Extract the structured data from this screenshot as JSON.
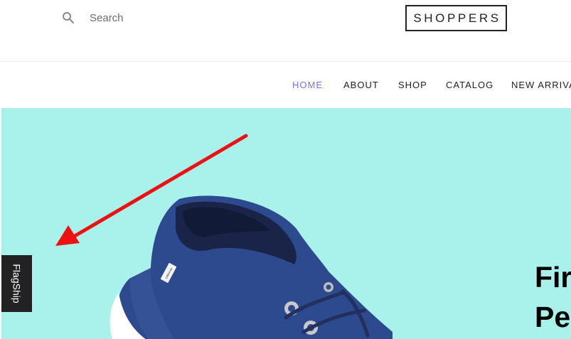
{
  "header": {
    "search": {
      "icon": "search-icon",
      "placeholder": "Search"
    },
    "logo_text": "SHOPPERS"
  },
  "nav": {
    "items": [
      {
        "label": "HOME",
        "active": true
      },
      {
        "label": "ABOUT",
        "active": false
      },
      {
        "label": "SHOP",
        "active": false
      },
      {
        "label": "CATALOG",
        "active": false
      },
      {
        "label": "NEW ARRIVALS",
        "active": false
      }
    ]
  },
  "hero": {
    "title": "Fir\nPe",
    "background_color": "#a9f2eb",
    "image": "blue-canvas-shoe",
    "shoe_tag_text": "Différente"
  },
  "annotation": {
    "arrow_color": "#ee1111"
  },
  "feedback_tab": {
    "label": "FlagShip"
  },
  "colors": {
    "accent": "#7971ea",
    "text": "#222222"
  }
}
